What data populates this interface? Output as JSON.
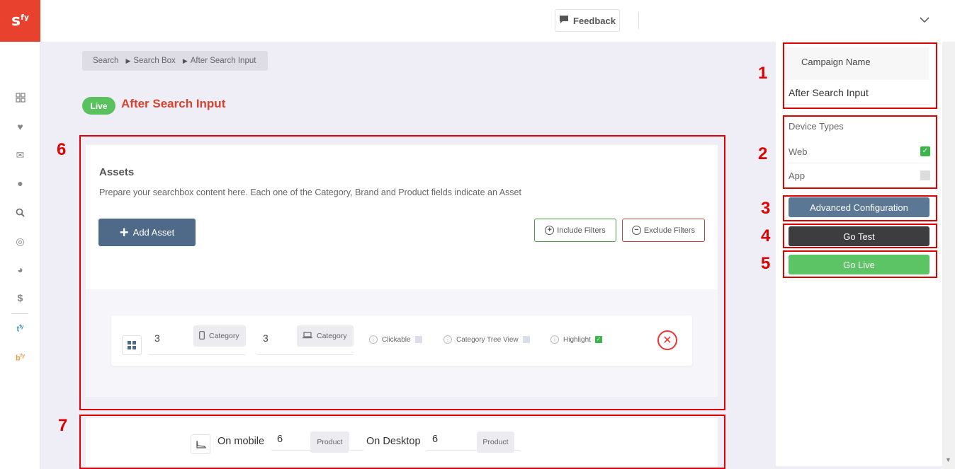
{
  "app": {
    "logo_text": "s",
    "logo_sup": "fy"
  },
  "sidebar": {
    "icons": [
      "grid-icon",
      "heart-icon",
      "mail-icon",
      "apple-icon",
      "search-icon",
      "target-icon",
      "pie-chart-icon",
      "dollar-icon"
    ],
    "tfy_label": "t",
    "tfy_sup": "fy",
    "bfy_label": "b",
    "bfy_sup": "fy"
  },
  "topbar": {
    "feedback_label": "Feedback"
  },
  "breadcrumb": [
    "Search",
    "Search Box",
    "After Search Input"
  ],
  "page": {
    "status_badge": "Live",
    "title": "After Search Input"
  },
  "annotations": [
    "1",
    "2",
    "3",
    "4",
    "5",
    "6",
    "7"
  ],
  "assets": {
    "title": "Assets",
    "description": "Prepare your searchbox content here. Each one of the Category, Brand and Product fields indicate an Asset",
    "add_label": "Add Asset",
    "include_label": "Include Filters",
    "exclude_label": "Exclude Filters",
    "row": {
      "mobile_count": "3",
      "mobile_type": "Category",
      "desktop_count": "3",
      "desktop_type": "Category",
      "clickable_label": "Clickable",
      "clickable_checked": false,
      "tree_label": "Category Tree View",
      "tree_checked": false,
      "highlight_label": "Highlight",
      "highlight_checked": true
    }
  },
  "product_limits": {
    "mobile_label": "On mobile",
    "mobile_value": "6",
    "mobile_type": "Product",
    "desktop_label": "On Desktop",
    "desktop_value": "6",
    "desktop_type": "Product"
  },
  "right_panel": {
    "campaign_name_label": "Campaign Name",
    "campaign_name_value": "After Search Input",
    "device_types_label": "Device Types",
    "devices": [
      {
        "label": "Web",
        "checked": true
      },
      {
        "label": "App",
        "checked": false
      }
    ],
    "advanced_label": "Advanced Configuration",
    "go_test_label": "Go Test",
    "go_live_label": "Go Live"
  },
  "colors": {
    "brand": "#e8412e",
    "live": "#59c25f",
    "annotation": "#e00000",
    "primary": "#4f6a88"
  }
}
